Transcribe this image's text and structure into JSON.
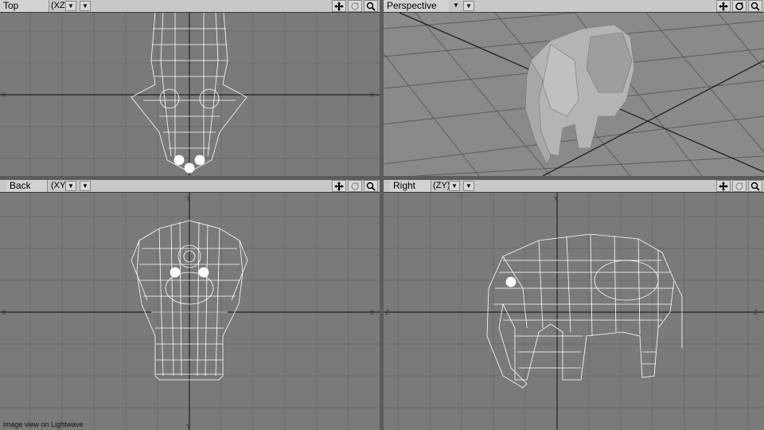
{
  "viewports": [
    {
      "id": "top",
      "label": "Top",
      "axis": "(XZ)"
    },
    {
      "id": "perspective",
      "label": "Perspective",
      "axis": ""
    },
    {
      "id": "back",
      "label": "Back",
      "axis": "(XY)"
    },
    {
      "id": "right",
      "label": "Right",
      "axis": "(ZY)"
    }
  ],
  "icons": [
    "move-icon",
    "rotate-icon",
    "zoom-icon",
    "dropdown-arrow-icon"
  ],
  "caption": "image view on Lightwave",
  "colors": {
    "grid_bg": "#7a7a7a",
    "grid_line": "#6a6a6a",
    "axis_line": "#2a2a2a",
    "wire": "#ffffff",
    "header": "#c8c8c8"
  }
}
